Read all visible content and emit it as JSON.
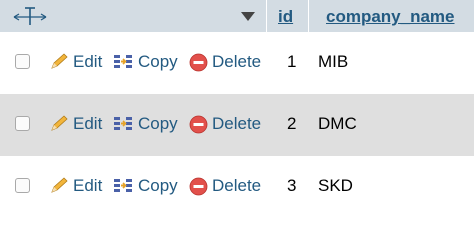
{
  "header": {
    "columns": [
      "id",
      "company_name"
    ]
  },
  "actions": {
    "edit": "Edit",
    "copy": "Copy",
    "delete": "Delete"
  },
  "rows": [
    {
      "id": "1",
      "company_name": "MIB"
    },
    {
      "id": "2",
      "company_name": "DMC"
    },
    {
      "id": "3",
      "company_name": "SKD"
    }
  ],
  "colors": {
    "header_bg": "#d3dce3",
    "link": "#235a81",
    "row_shaded": "#dfdfdf",
    "delete_icon": "#e2504b"
  },
  "icons": [
    "left-right-arrows-icon",
    "sort-caret-icon",
    "pencil-icon",
    "copy-icon",
    "delete-icon"
  ]
}
